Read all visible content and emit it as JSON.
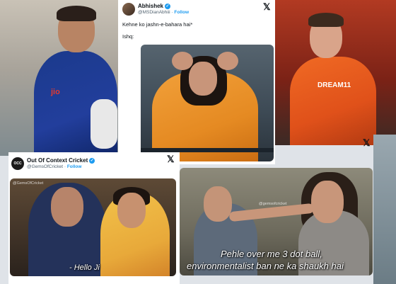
{
  "colors": {
    "accent": "#1d9bf0",
    "lsg_jersey": "#1b3a8c",
    "srh_jersey": "#f06a24"
  },
  "background_left": {
    "jersey_logo": "jio"
  },
  "background_right": {
    "jersey_logo": "DREAM11"
  },
  "tweet1": {
    "name": "Abhishek",
    "handle": "@MSDianAbhiii",
    "follow_label": "Follow",
    "separator": "·",
    "text_line1": "Kehne ko jashn-e-bahara hai*",
    "text_line2": "Ishq:",
    "close_icon": "x-logo-icon"
  },
  "tweet2": {
    "name": "Out Of Context Cricket",
    "handle": "@GemsOfCricket",
    "follow_label": "Follow",
    "separator": "·",
    "avatar_text": "OCC",
    "close_icon": "x-logo-icon",
    "left_media": {
      "caption": "- Hello Ji",
      "watermark": "@GemsOfCricket"
    },
    "right_media": {
      "caption_line1": "Pehle over me 3 dot ball,",
      "caption_line2": "environmentalist ban ne ka shaukh hai",
      "watermark": "@gemsofcricket"
    }
  },
  "floating_close_icon": "x-logo-icon"
}
